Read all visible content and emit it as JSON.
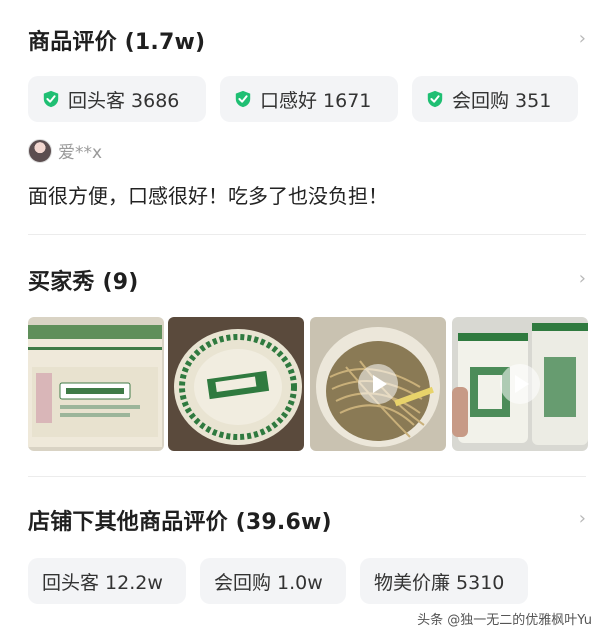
{
  "reviews": {
    "title": "商品评价 (1.7w)",
    "tags": [
      "回头客 3686",
      "口感好 1671",
      "会回购 351"
    ],
    "reviewer_name": "爱**x",
    "review_text": "面很方便，口感很好！吃多了也没负担！"
  },
  "buyer_show": {
    "title": "买家秀 (9)",
    "media_types": [
      "image",
      "image",
      "video",
      "video"
    ]
  },
  "store_reviews": {
    "title": "店铺下其他商品评价 (39.6w)",
    "tags": [
      "回头客 12.2w",
      "会回购 1.0w",
      "物美价廉 5310"
    ]
  },
  "watermark": "头条 @独一无二的优雅枫叶Yu",
  "icons": {
    "chevron": "chevron-right-icon",
    "check": "check-shield-icon",
    "play": "play-icon"
  },
  "colors": {
    "check_green": "#1fbf73",
    "tag_bg": "#f3f4f6"
  }
}
